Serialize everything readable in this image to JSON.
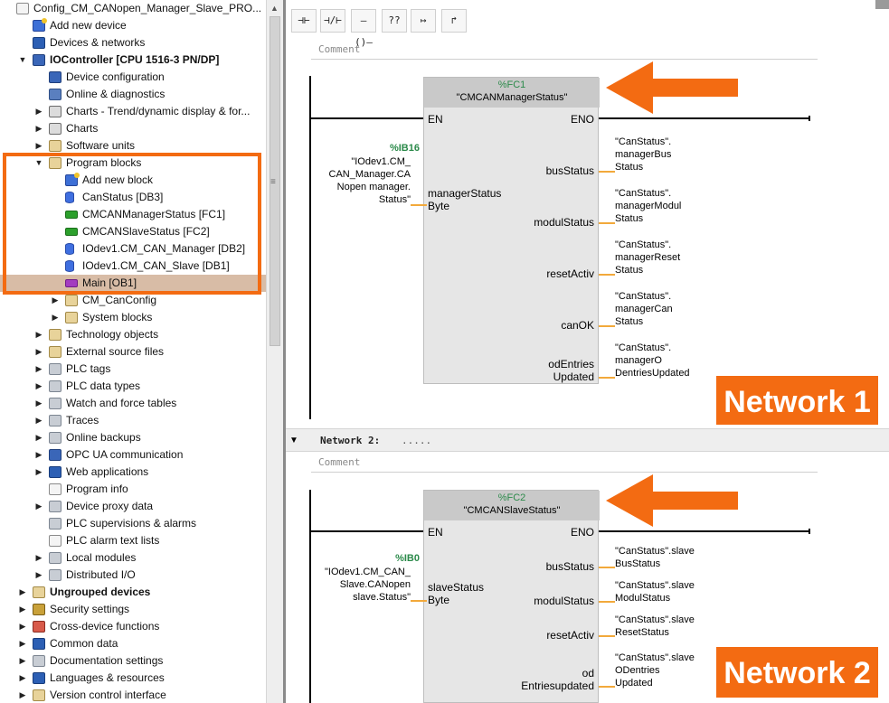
{
  "colors": {
    "accent": "#f36b12",
    "selected_row": "#d8bca6",
    "address_green": "#2b8a4a",
    "block_fill": "#e6e6e6",
    "pin_wire": "#f2a93b"
  },
  "tree": {
    "items": [
      {
        "label": "Config_CM_CANopen_Manager_Slave_PRO...",
        "icon": "doc-icon"
      },
      {
        "label": "Add new device",
        "icon": "add-device-icon"
      },
      {
        "label": "Devices & networks",
        "icon": "network-icon"
      },
      {
        "label": "IOController [CPU 1516-3 PN/DP]",
        "icon": "plc-icon"
      },
      {
        "label": "Device configuration",
        "icon": "device-config-icon"
      },
      {
        "label": "Online & diagnostics",
        "icon": "diagnostics-icon"
      },
      {
        "label": "Charts - Trend/dynamic display & for...",
        "icon": "chart-icon"
      },
      {
        "label": "Charts",
        "icon": "chart-icon"
      },
      {
        "label": "Software units",
        "icon": "folder-icon"
      },
      {
        "label": "Program blocks",
        "icon": "folder-icon"
      },
      {
        "label": "Add new block",
        "icon": "add-block-icon"
      },
      {
        "label": "CanStatus [DB3]",
        "icon": "db-icon"
      },
      {
        "label": "CMCANManagerStatus [FC1]",
        "icon": "fc-icon"
      },
      {
        "label": "CMCANSlaveStatus [FC2]",
        "icon": "fc-icon"
      },
      {
        "label": "IOdev1.CM_CAN_Manager [DB2]",
        "icon": "db-icon"
      },
      {
        "label": "IOdev1.CM_CAN_Slave [DB1]",
        "icon": "db-icon"
      },
      {
        "label": "Main [OB1]",
        "icon": "ob-icon"
      },
      {
        "label": "CM_CanConfig",
        "icon": "folder-icon"
      },
      {
        "label": "System blocks",
        "icon": "folder-icon"
      },
      {
        "label": "Technology objects",
        "icon": "folder-icon"
      },
      {
        "label": "External source files",
        "icon": "folder-icon"
      },
      {
        "label": "PLC tags",
        "icon": "tags-icon"
      },
      {
        "label": "PLC data types",
        "icon": "datatypes-icon"
      },
      {
        "label": "Watch and force tables",
        "icon": "watch-icon"
      },
      {
        "label": "Traces",
        "icon": "trace-icon"
      },
      {
        "label": "Online backups",
        "icon": "backup-icon"
      },
      {
        "label": "OPC UA communication",
        "icon": "opcua-icon"
      },
      {
        "label": "Web applications",
        "icon": "web-icon"
      },
      {
        "label": "Program info",
        "icon": "info-icon"
      },
      {
        "label": "Device proxy data",
        "icon": "proxy-icon"
      },
      {
        "label": "PLC supervisions & alarms",
        "icon": "alarm-icon"
      },
      {
        "label": "PLC alarm text lists",
        "icon": "textlist-icon"
      },
      {
        "label": "Local modules",
        "icon": "module-icon"
      },
      {
        "label": "Distributed I/O",
        "icon": "distributed-io-icon"
      },
      {
        "label": "Ungrouped devices",
        "icon": "folder-icon"
      },
      {
        "label": "Security settings",
        "icon": "security-icon"
      },
      {
        "label": "Cross-device functions",
        "icon": "cross-device-icon"
      },
      {
        "label": "Common data",
        "icon": "common-data-icon"
      },
      {
        "label": "Documentation settings",
        "icon": "doc-settings-icon"
      },
      {
        "label": "Languages & resources",
        "icon": "languages-icon"
      },
      {
        "label": "Version control interface",
        "icon": "version-control-icon"
      }
    ]
  },
  "toolbar": {
    "buttons": [
      {
        "label": "⊣⊢",
        "icon": "no-contact-icon"
      },
      {
        "label": "⊣/⊢",
        "icon": "nc-contact-icon"
      },
      {
        "label": "–()–",
        "icon": "coil-icon"
      },
      {
        "label": "??",
        "icon": "empty-box-icon"
      },
      {
        "label": "↦",
        "icon": "open-branch-icon"
      },
      {
        "label": "↱",
        "icon": "close-branch-icon"
      }
    ]
  },
  "network1": {
    "comment": "Comment",
    "block_number": "%FC1",
    "block_name": "\"CMCANManagerStatus\"",
    "en": "EN",
    "eno": "ENO",
    "input_address": "%IB16",
    "input_operand": "\"IOdev1.CM_\nCAN_Manager.CA\nNopen manager.\nStatus\"",
    "input_pin": "managerStatus\nByte",
    "outputs": [
      {
        "pin": "busStatus",
        "operand": "\"CanStatus\".\nmanagerBus\nStatus"
      },
      {
        "pin": "modulStatus",
        "operand": "\"CanStatus\".\nmanagerModul\nStatus"
      },
      {
        "pin": "resetActiv",
        "operand": "\"CanStatus\".\nmanagerReset\nStatus"
      },
      {
        "pin": "canOK",
        "operand": "\"CanStatus\".\nmanagerCan\nStatus"
      },
      {
        "pin": "odEntries\nUpdated",
        "operand": "\"CanStatus\".\nmanagerO\nDentriesUpdated"
      }
    ],
    "label": "Network 1"
  },
  "network2": {
    "title": "Network 2:",
    "title_dots": ".....",
    "comment": "Comment",
    "block_number": "%FC2",
    "block_name": "\"CMCANSlaveStatus\"",
    "en": "EN",
    "eno": "ENO",
    "input_address": "%IB0",
    "input_operand": "\"IOdev1.CM_CAN_\nSlave.CANopen\nslave.Status\"",
    "input_pin": "slaveStatus\nByte",
    "outputs": [
      {
        "pin": "busStatus",
        "operand": "\"CanStatus\".slave\nBusStatus"
      },
      {
        "pin": "modulStatus",
        "operand": "\"CanStatus\".slave\nModulStatus"
      },
      {
        "pin": "resetActiv",
        "operand": "\"CanStatus\".slave\nResetStatus"
      },
      {
        "pin": "od\nEntriesupdated",
        "operand": "\"CanStatus\".slave\nODentries\nUpdated"
      }
    ],
    "label": "Network 2"
  }
}
